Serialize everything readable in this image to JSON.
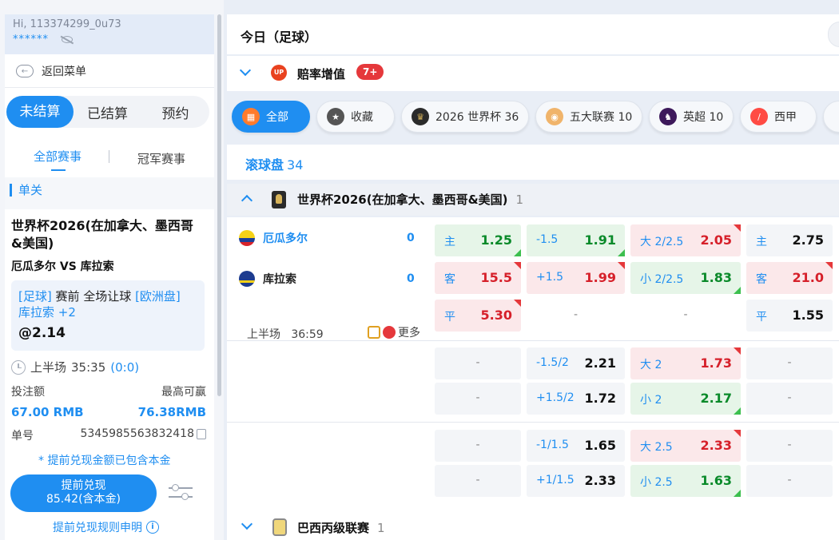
{
  "account": {
    "greeting": "Hi, 113374299_0u73",
    "masked_balance": "******"
  },
  "nav": {
    "back_label": "返回菜单"
  },
  "bet_tabs": [
    "未结算",
    "已结算",
    "预约"
  ],
  "sub_tabs": [
    "全部赛事",
    "冠军赛事"
  ],
  "bet_slip": {
    "type_label": "单关",
    "league": "世界杯2026(在加拿大、墨西哥&美国)",
    "match": "厄瓜多尔 VS 库拉索",
    "sport_tag": "[足球]",
    "market": "赛前 全场让球",
    "odds_type": "[欧洲盘]",
    "selection": "库拉索 +2",
    "odds": "@2.14",
    "period": "上半场",
    "time": "35:35",
    "score": "(0:0)",
    "stake_label": "投注额",
    "max_win_label": "最高可赢",
    "stake": "67.00 RMB",
    "max_win": "76.38RMB",
    "ticket_label": "单号",
    "ticket_no": "5345985563832418",
    "cashout_note": "* 提前兑现金额已包含本金",
    "cashout_title": "提前兑现",
    "cashout_amount": "85.42(含本金)",
    "cashout_rules": "提前兑现规则申明"
  },
  "main": {
    "page_title": "今日（足球）",
    "boost": {
      "icon_text": "UP",
      "label": "赔率增值",
      "badge": "7+"
    },
    "filters": [
      {
        "label": "全部",
        "icon": "grid-icon",
        "active": true
      },
      {
        "label": "收藏",
        "icon": "star-icon"
      },
      {
        "label": "2026 世界杯 36",
        "icon": "world-cup-icon"
      },
      {
        "label": "五大联赛 10",
        "icon": "five-leagues-icon"
      },
      {
        "label": "英超 10",
        "icon": "premier-league-icon"
      },
      {
        "label": "西甲",
        "icon": "laliga-icon"
      }
    ],
    "live": {
      "label": "滚球盘",
      "count": "34"
    },
    "league1": {
      "name": "世界杯2026(在加拿大、墨西哥&美国)",
      "count": "1"
    },
    "match": {
      "home": "厄瓜多尔",
      "away": "库拉索",
      "home_score": "0",
      "away_score": "0",
      "period": "上半场",
      "clock": "36:59",
      "more": "更多"
    },
    "odds_rows": [
      {
        "c1": [
          "主",
          "1.25"
        ],
        "c2": [
          "-1.5",
          "1.91"
        ],
        "c3": [
          "大 2/2.5",
          "2.05"
        ],
        "c4": [
          "主",
          "2.75"
        ]
      },
      {
        "c1": [
          "客",
          "15.5"
        ],
        "c2": [
          "+1.5",
          "1.99"
        ],
        "c3": [
          "小 2/2.5",
          "1.83"
        ],
        "c4": [
          "客",
          "21.0"
        ]
      },
      {
        "c1": [
          "平",
          "5.30"
        ],
        "c2": [
          "-",
          ""
        ],
        "c3": [
          "-",
          ""
        ],
        "c4": [
          "平",
          "1.55"
        ]
      },
      {
        "c1": [
          "-",
          ""
        ],
        "c2": [
          "-1.5/2",
          "2.21"
        ],
        "c3": [
          "大 2",
          "1.73"
        ],
        "c4": [
          "-",
          ""
        ]
      },
      {
        "c1": [
          "-",
          ""
        ],
        "c2": [
          "+1.5/2",
          "1.72"
        ],
        "c3": [
          "小 2",
          "2.17"
        ],
        "c4": [
          "-",
          ""
        ]
      },
      {
        "c1": [
          "-",
          ""
        ],
        "c2": [
          "-1/1.5",
          "1.65"
        ],
        "c3": [
          "大 2.5",
          "2.33"
        ],
        "c4": [
          "-",
          ""
        ]
      },
      {
        "c1": [
          "-",
          ""
        ],
        "c2": [
          "+1/1.5",
          "2.33"
        ],
        "c3": [
          "小 2.5",
          "1.63"
        ],
        "c4": [
          "-",
          ""
        ]
      }
    ],
    "league2": {
      "name": "巴西丙级联赛",
      "count": "1"
    }
  }
}
